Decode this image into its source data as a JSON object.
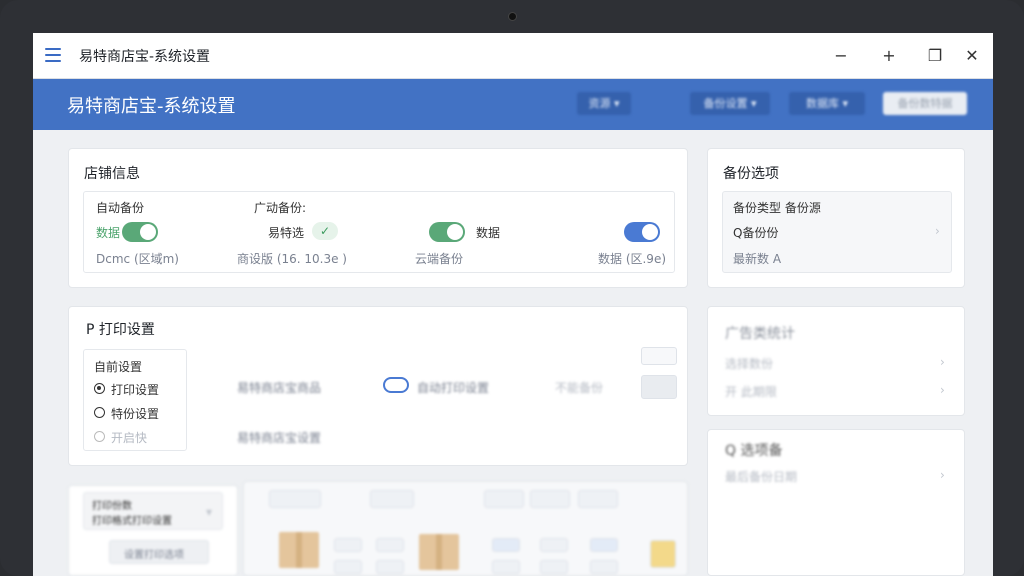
{
  "titlebar": {
    "title": "易特商店宝-系统设置",
    "minimize": "−",
    "maximize": "+",
    "restore": "❐",
    "close": "✕"
  },
  "header": {
    "title": "易特商店宝-系统设置",
    "btn1": "资源 ▾",
    "btn2": "备份设置 ▾",
    "btn3": "数据库 ▾",
    "btn4": "备份数特据"
  },
  "store": {
    "title": "店铺信息",
    "auto_backup": "自动备份",
    "manual_backup": "广动备份:",
    "status_on": "数据",
    "scheme_label": "易特选",
    "switch3_label": "数据",
    "path_note": "Dcmc (区域m)",
    "time_note": "商设版 (16. 10.3e )",
    "cloud_note": "云端备份",
    "version_note": "数据 (区.9e)"
  },
  "backup": {
    "title": "备份选项",
    "subtitle": "备份类型 备份源",
    "row1": "Q备份份",
    "row2": "最新数 A"
  },
  "print": {
    "title": "P 打印设置",
    "opt1": "自前设置",
    "opt2": "打印设置",
    "opt3": "特份设置",
    "opt4": "开启快",
    "row_a": "易特商店宝商品",
    "row_b": "自动打印设置",
    "row_c": "不能备份",
    "row_d": "易特商店宝设置"
  },
  "advanced": {
    "title": "广告类统计",
    "row1": "选择数份",
    "row2": "开 此期限"
  },
  "search": {
    "title": "Q 选项备",
    "row1": "最后备份日期"
  },
  "bottom_left": {
    "line1": "打印份数",
    "line2": "打印格式打印设置",
    "btn": "设置打印选项"
  },
  "colors": {
    "accent": "#4272c4",
    "toggle_green": "#5aa878",
    "toggle_blue": "#4a7ad3"
  }
}
